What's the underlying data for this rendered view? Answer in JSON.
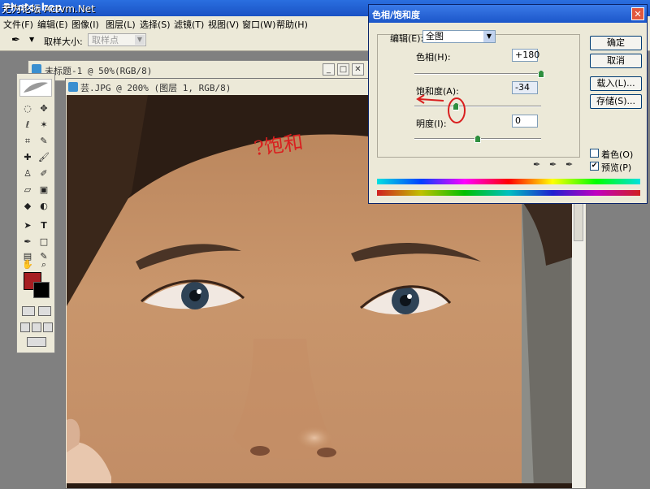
{
  "app": {
    "title": "Photoshop",
    "watermark": "无为论坛 Actvm.Net"
  },
  "menu": [
    "文件(F)",
    "编辑(E)",
    "图像(I)",
    "图层(L)",
    "选择(S)",
    "滤镜(T)",
    "视图(V)",
    "窗口(W)",
    "帮助(H)"
  ],
  "options_bar": {
    "sample_size_label": "取样大小:",
    "sample_size_value": "取样点"
  },
  "doc_windows": [
    {
      "title": "未标题-1 @ 50%(RGB/8)"
    },
    {
      "title": "芸.JPG @ 200% (图层 1, RGB/8)"
    }
  ],
  "dialog": {
    "title": "色相/饱和度",
    "edit_label": "编辑(E):",
    "edit_value": "全图",
    "hue": {
      "label": "色相(H):",
      "value": "+180",
      "slider_fraction": 1.0
    },
    "saturation": {
      "label": "饱和度(A):",
      "value": "-34",
      "slider_fraction": 0.33
    },
    "lightness": {
      "label": "明度(I):",
      "value": "0",
      "slider_fraction": 0.5
    },
    "buttons": {
      "ok": "确定",
      "cancel": "取消",
      "load": "载入(L)...",
      "save": "存储(S)..."
    },
    "colorize": {
      "label": "着色(O)",
      "checked": false
    },
    "preview": {
      "label": "预览(P)",
      "checked": true
    }
  },
  "annotation": {
    "text": "?饱和",
    "color": "#d91f1f"
  }
}
